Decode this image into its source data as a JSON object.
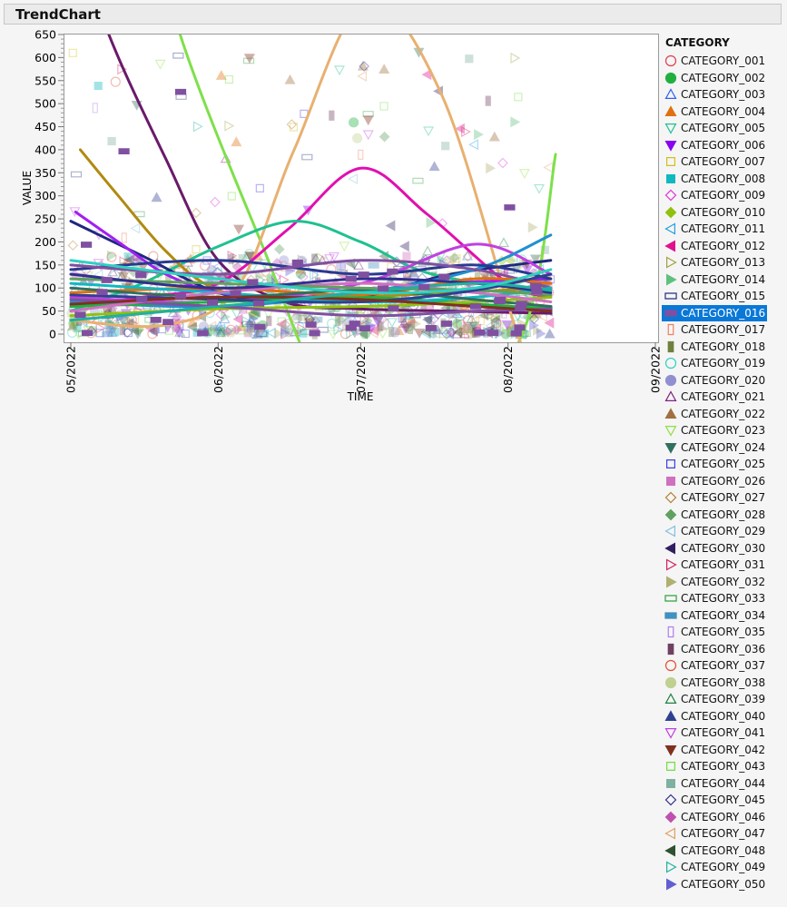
{
  "window": {
    "title": "TrendChart"
  },
  "chart_data": {
    "type": "scatter",
    "title": "TrendChart",
    "xlabel": "TIME",
    "ylabel": "VALUE",
    "ylim": [
      0,
      650
    ],
    "yticks": [
      "0",
      "50",
      "100",
      "150",
      "200",
      "250",
      "300",
      "350",
      "400",
      "450",
      "500",
      "550",
      "600",
      "650"
    ],
    "xticks": [
      {
        "label": "05/2022",
        "day": 0
      },
      {
        "label": "06/2022",
        "day": 31
      },
      {
        "label": "07/2022",
        "day": 61
      },
      {
        "label": "08/2022",
        "day": 92
      },
      {
        "label": "09/2022",
        "day": 123
      }
    ],
    "x_unit": "days since 05/01/2022",
    "legend_title": "CATEGORY",
    "legend_position": "right",
    "selected_category": "CATEGORY_016",
    "categories": [
      {
        "name": "CATEGORY_001",
        "shape": "circle",
        "filled": false,
        "color": "#e03c4c"
      },
      {
        "name": "CATEGORY_002",
        "shape": "circle",
        "filled": true,
        "color": "#20b040"
      },
      {
        "name": "CATEGORY_003",
        "shape": "triangle",
        "filled": false,
        "color": "#3060f0"
      },
      {
        "name": "CATEGORY_004",
        "shape": "triangle",
        "filled": true,
        "color": "#e07010"
      },
      {
        "name": "CATEGORY_005",
        "shape": "tridown",
        "filled": false,
        "color": "#20c090"
      },
      {
        "name": "CATEGORY_006",
        "shape": "tridown",
        "filled": true,
        "color": "#8a00f0"
      },
      {
        "name": "CATEGORY_007",
        "shape": "square",
        "filled": false,
        "color": "#d0c020"
      },
      {
        "name": "CATEGORY_008",
        "shape": "square",
        "filled": true,
        "color": "#10b8c0"
      },
      {
        "name": "CATEGORY_009",
        "shape": "diamond",
        "filled": false,
        "color": "#e030e0"
      },
      {
        "name": "CATEGORY_010",
        "shape": "diamond",
        "filled": true,
        "color": "#90c010"
      },
      {
        "name": "CATEGORY_011",
        "shape": "trileft",
        "filled": false,
        "color": "#20a0e0"
      },
      {
        "name": "CATEGORY_012",
        "shape": "trileft",
        "filled": true,
        "color": "#e01090"
      },
      {
        "name": "CATEGORY_013",
        "shape": "triright",
        "filled": false,
        "color": "#a0a040"
      },
      {
        "name": "CATEGORY_014",
        "shape": "triright",
        "filled": true,
        "color": "#60c080"
      },
      {
        "name": "CATEGORY_015",
        "shape": "rect",
        "filled": false,
        "color": "#203080"
      },
      {
        "name": "CATEGORY_016",
        "shape": "rect",
        "filled": true,
        "color": "#8050a0"
      },
      {
        "name": "CATEGORY_017",
        "shape": "vrect",
        "filled": false,
        "color": "#f08060"
      },
      {
        "name": "CATEGORY_018",
        "shape": "vrect",
        "filled": true,
        "color": "#708040"
      },
      {
        "name": "CATEGORY_019",
        "shape": "circle",
        "filled": false,
        "color": "#30d0c0"
      },
      {
        "name": "CATEGORY_020",
        "shape": "circle",
        "filled": true,
        "color": "#9090d0"
      },
      {
        "name": "CATEGORY_021",
        "shape": "triangle",
        "filled": false,
        "color": "#802080"
      },
      {
        "name": "CATEGORY_022",
        "shape": "triangle",
        "filled": true,
        "color": "#a07040"
      },
      {
        "name": "CATEGORY_023",
        "shape": "tridown",
        "filled": false,
        "color": "#90e040"
      },
      {
        "name": "CATEGORY_024",
        "shape": "tridown",
        "filled": true,
        "color": "#307060"
      },
      {
        "name": "CATEGORY_025",
        "shape": "square",
        "filled": false,
        "color": "#4040e0"
      },
      {
        "name": "CATEGORY_026",
        "shape": "square",
        "filled": true,
        "color": "#d070c0"
      },
      {
        "name": "CATEGORY_027",
        "shape": "diamond",
        "filled": false,
        "color": "#b08030"
      },
      {
        "name": "CATEGORY_028",
        "shape": "diamond",
        "filled": true,
        "color": "#60a060"
      },
      {
        "name": "CATEGORY_029",
        "shape": "trileft",
        "filled": false,
        "color": "#80c0e0"
      },
      {
        "name": "CATEGORY_030",
        "shape": "trileft",
        "filled": true,
        "color": "#302060"
      },
      {
        "name": "CATEGORY_031",
        "shape": "triright",
        "filled": false,
        "color": "#d02060"
      },
      {
        "name": "CATEGORY_032",
        "shape": "triright",
        "filled": true,
        "color": "#b0b070"
      },
      {
        "name": "CATEGORY_033",
        "shape": "rect",
        "filled": false,
        "color": "#30a040"
      },
      {
        "name": "CATEGORY_034",
        "shape": "rect",
        "filled": true,
        "color": "#4090c0"
      },
      {
        "name": "CATEGORY_035",
        "shape": "vrect",
        "filled": false,
        "color": "#b080f0"
      },
      {
        "name": "CATEGORY_036",
        "shape": "vrect",
        "filled": true,
        "color": "#704060"
      },
      {
        "name": "CATEGORY_037",
        "shape": "circle",
        "filled": false,
        "color": "#e05030"
      },
      {
        "name": "CATEGORY_038",
        "shape": "circle",
        "filled": true,
        "color": "#c0d090"
      },
      {
        "name": "CATEGORY_039",
        "shape": "triangle",
        "filled": false,
        "color": "#208040"
      },
      {
        "name": "CATEGORY_040",
        "shape": "triangle",
        "filled": true,
        "color": "#304090"
      },
      {
        "name": "CATEGORY_041",
        "shape": "tridown",
        "filled": false,
        "color": "#c040e0"
      },
      {
        "name": "CATEGORY_042",
        "shape": "tridown",
        "filled": true,
        "color": "#803020"
      },
      {
        "name": "CATEGORY_043",
        "shape": "square",
        "filled": false,
        "color": "#70e040"
      },
      {
        "name": "CATEGORY_044",
        "shape": "square",
        "filled": true,
        "color": "#80b0a0"
      },
      {
        "name": "CATEGORY_045",
        "shape": "diamond",
        "filled": false,
        "color": "#303090"
      },
      {
        "name": "CATEGORY_046",
        "shape": "diamond",
        "filled": true,
        "color": "#c050b0"
      },
      {
        "name": "CATEGORY_047",
        "shape": "trileft",
        "filled": false,
        "color": "#e0a060"
      },
      {
        "name": "CATEGORY_048",
        "shape": "trileft",
        "filled": true,
        "color": "#305030"
      },
      {
        "name": "CATEGORY_049",
        "shape": "triright",
        "filled": false,
        "color": "#20b0a0"
      },
      {
        "name": "CATEGORY_050",
        "shape": "triright",
        "filled": true,
        "color": "#6060d0"
      }
    ],
    "trend_series": [
      {
        "name": "CATEGORY_036",
        "color": "#6a1a6a",
        "x": [
          0,
          8,
          20,
          31,
          45,
          60,
          80,
          101
        ],
        "y": [
          900,
          650,
          380,
          160,
          70,
          55,
          50,
          45
        ]
      },
      {
        "name": "CATEGORY_043",
        "color": "#7ee04a",
        "x": [
          15,
          23,
          40,
          55,
          75,
          95,
          102
        ],
        "y": [
          1000,
          650,
          200,
          -150,
          -250,
          0,
          390
        ]
      },
      {
        "name": "CATEGORY_047",
        "color": "#e8b070",
        "x": [
          0,
          20,
          35,
          47,
          62,
          78,
          94,
          101
        ],
        "y": [
          30,
          20,
          100,
          400,
          720,
          520,
          0,
          -150
        ]
      },
      {
        "name": "CATEGORY_012",
        "color": "#e010b0",
        "x": [
          0,
          15,
          31,
          46,
          61,
          75,
          92,
          101
        ],
        "y": [
          60,
          80,
          110,
          230,
          360,
          260,
          110,
          80
        ]
      },
      {
        "name": "CATEGORY_005",
        "color": "#20c090",
        "x": [
          0,
          15,
          31,
          47,
          61,
          76,
          101
        ],
        "y": [
          50,
          110,
          190,
          245,
          200,
          130,
          90
        ]
      },
      {
        "name": "CATEGORY_022",
        "color": "#b08a10",
        "x": [
          2,
          10,
          20,
          30,
          45,
          61,
          80,
          101
        ],
        "y": [
          400,
          300,
          180,
          100,
          70,
          80,
          90,
          100
        ]
      },
      {
        "name": "CATEGORY_030",
        "color": "#202880",
        "x": [
          0,
          15,
          31,
          46,
          61,
          80,
          101
        ],
        "y": [
          245,
          170,
          90,
          70,
          80,
          130,
          160
        ]
      },
      {
        "name": "CATEGORY_006",
        "color": "#a020f0",
        "x": [
          1,
          10,
          20,
          31,
          46,
          61,
          80,
          101
        ],
        "y": [
          265,
          200,
          130,
          90,
          80,
          90,
          110,
          120
        ]
      },
      {
        "name": "CATEGORY_041",
        "color": "#c040e0",
        "x": [
          0,
          31,
          61,
          85,
          101
        ],
        "y": [
          80,
          70,
          110,
          195,
          130
        ]
      },
      {
        "name": "CATEGORY_034",
        "color": "#2090d0",
        "x": [
          0,
          31,
          61,
          85,
          101
        ],
        "y": [
          70,
          60,
          90,
          140,
          215
        ]
      },
      {
        "name": "CATEGORY_015",
        "color": "#2a3a90",
        "x": [
          0,
          31,
          61,
          85,
          101
        ],
        "y": [
          140,
          160,
          130,
          150,
          120
        ]
      },
      {
        "name": "CATEGORY_021",
        "color": "#8050a0",
        "x": [
          0,
          31,
          61,
          85,
          101
        ],
        "y": [
          150,
          130,
          160,
          140,
          100
        ]
      },
      {
        "name": "CATEGORY_002",
        "color": "#20b040",
        "x": [
          0,
          31,
          61,
          85,
          101
        ],
        "y": [
          60,
          70,
          80,
          65,
          55
        ]
      },
      {
        "name": "CATEGORY_004",
        "color": "#e07010",
        "x": [
          0,
          31,
          61,
          85,
          101
        ],
        "y": [
          90,
          100,
          85,
          120,
          110
        ]
      },
      {
        "name": "CATEGORY_008",
        "color": "#10b8c0",
        "x": [
          0,
          31,
          61,
          85,
          101
        ],
        "y": [
          110,
          90,
          70,
          80,
          100
        ]
      },
      {
        "name": "CATEGORY_010",
        "color": "#90c010",
        "x": [
          0,
          31,
          61,
          85,
          101
        ],
        "y": [
          40,
          55,
          60,
          70,
          80
        ]
      },
      {
        "name": "CATEGORY_016",
        "color": "#8050a0",
        "x": [
          0,
          31,
          61,
          85,
          101
        ],
        "y": [
          75,
          60,
          40,
          50,
          55
        ]
      },
      {
        "name": "CATEGORY_024",
        "color": "#307060",
        "x": [
          0,
          31,
          61,
          85,
          101
        ],
        "y": [
          100,
          80,
          95,
          75,
          60
        ]
      },
      {
        "name": "CATEGORY_026",
        "color": "#d070c0",
        "x": [
          0,
          31,
          61,
          85,
          101
        ],
        "y": [
          50,
          90,
          110,
          90,
          70
        ]
      },
      {
        "name": "CATEGORY_028",
        "color": "#60a060",
        "x": [
          0,
          31,
          61,
          85,
          101
        ],
        "y": [
          120,
          110,
          100,
          95,
          85
        ]
      },
      {
        "name": "CATEGORY_040",
        "color": "#304090",
        "x": [
          0,
          31,
          61,
          85,
          101
        ],
        "y": [
          85,
          75,
          70,
          95,
          130
        ]
      },
      {
        "name": "CATEGORY_042",
        "color": "#803020",
        "x": [
          0,
          31,
          61,
          85,
          101
        ],
        "y": [
          65,
          80,
          75,
          60,
          50
        ]
      },
      {
        "name": "CATEGORY_045",
        "color": "#303090",
        "x": [
          0,
          31,
          61,
          85,
          101
        ],
        "y": [
          130,
          100,
          120,
          110,
          90
        ]
      },
      {
        "name": "CATEGORY_049",
        "color": "#20b0a0",
        "x": [
          0,
          31,
          61,
          85,
          101
        ],
        "y": [
          30,
          60,
          90,
          110,
          95
        ]
      },
      {
        "name": "CATEGORY_019",
        "color": "#30d0c0",
        "x": [
          0,
          31,
          61,
          85,
          101
        ],
        "y": [
          160,
          120,
          90,
          100,
          140
        ]
      }
    ]
  }
}
